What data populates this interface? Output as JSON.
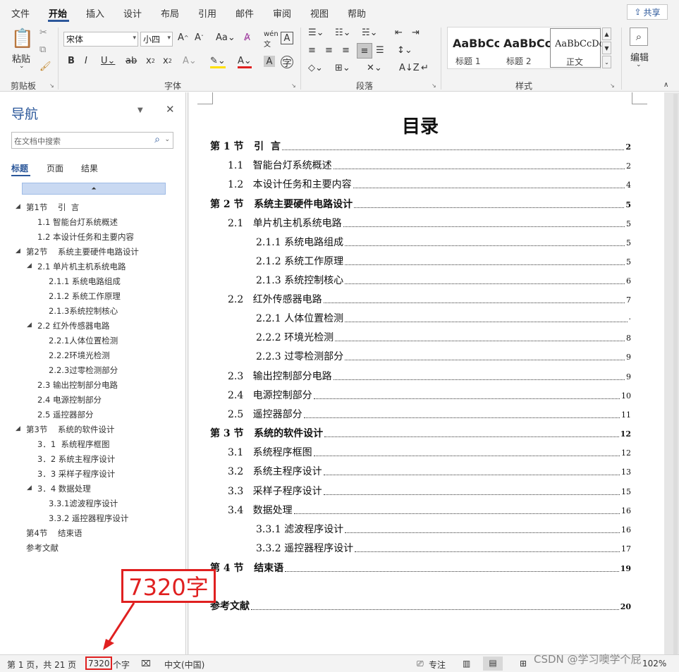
{
  "menu": {
    "items": [
      "文件",
      "开始",
      "插入",
      "设计",
      "布局",
      "引用",
      "邮件",
      "审阅",
      "视图",
      "帮助"
    ],
    "share": "共享"
  },
  "ribbon": {
    "clipboard": {
      "paste": "粘贴",
      "label": "剪贴板"
    },
    "font": {
      "name": "宋体",
      "size": "小四",
      "label": "字体"
    },
    "paragraph": {
      "label": "段落"
    },
    "styles": {
      "label": "样式",
      "items": [
        {
          "sample": "AaBbCc",
          "name": "标题 1"
        },
        {
          "sample": "AaBbCc",
          "name": "标题 2"
        },
        {
          "sample": "AaBbCcDc",
          "name": "正文"
        }
      ]
    },
    "edit": {
      "label": "编辑"
    }
  },
  "nav": {
    "title": "导航",
    "search_placeholder": "在文档中搜索",
    "tabs": [
      "标题",
      "页面",
      "结果"
    ],
    "items": [
      {
        "text": "第1节    引  言",
        "expanded": true
      },
      {
        "text": "1.1 智能台灯系统概述"
      },
      {
        "text": "1.2 本设计任务和主要内容"
      },
      {
        "text": "第2节    系统主要硬件电路设计",
        "expanded": true
      },
      {
        "text": "2.1 单片机主机系统电路",
        "expanded": true
      },
      {
        "text": "2.1.1 系统电路组成"
      },
      {
        "text": "2.1.2 系统工作原理"
      },
      {
        "text": "2.1.3系统控制核心"
      },
      {
        "text": "2.2 红外传感器电路",
        "expanded": true
      },
      {
        "text": "2.2.1人体位置检测"
      },
      {
        "text": "2.2.2环境光检测"
      },
      {
        "text": "2.2.3过零检测部分"
      },
      {
        "text": "2.3 输出控制部分电路"
      },
      {
        "text": "2.4 电源控制部分"
      },
      {
        "text": "2.5 遥控器部分"
      },
      {
        "text": "第3节    系统的软件设计",
        "expanded": true
      },
      {
        "text": "3．1  系统程序框图"
      },
      {
        "text": "3．2 系统主程序设计"
      },
      {
        "text": "3．3 采样子程序设计"
      },
      {
        "text": "3．4 数据处理",
        "expanded": true
      },
      {
        "text": "3.3.1滤波程序设计"
      },
      {
        "text": "3.3.2 遥控器程序设计"
      },
      {
        "text": "第4节    结束语"
      },
      {
        "text": "参考文献"
      }
    ]
  },
  "doc": {
    "title": "目录",
    "toc": [
      {
        "text": "第 1 节   引  言",
        "page": "2"
      },
      {
        "text": "1.1   智能台灯系统概述",
        "page": "2"
      },
      {
        "text": "1.2   本设计任务和主要内容",
        "page": "4"
      },
      {
        "text": "第 2 节   系统主要硬件电路设计",
        "page": "5"
      },
      {
        "text": "2.1   单片机主机系统电路",
        "page": "5"
      },
      {
        "text": "2.1.1 系统电路组成",
        "page": "5"
      },
      {
        "text": "2.1.2 系统工作原理",
        "page": "5"
      },
      {
        "text": "2.1.3 系统控制核心",
        "page": "6"
      },
      {
        "text": "2.2   红外传感器电路",
        "page": "7"
      },
      {
        "text": "2.2.1 人体位置检测",
        "page": "·"
      },
      {
        "text": "2.2.2 环境光检测",
        "page": "8"
      },
      {
        "text": "2.2.3 过零检测部分",
        "page": "9"
      },
      {
        "text": "2.3   输出控制部分电路",
        "page": "9"
      },
      {
        "text": "2.4   电源控制部分",
        "page": "10"
      },
      {
        "text": "2.5   遥控器部分",
        "page": "11"
      },
      {
        "text": "第 3 节   系统的软件设计",
        "page": "12"
      },
      {
        "text": "3.1   系统程序框图",
        "page": "12"
      },
      {
        "text": "3.2   系统主程序设计",
        "page": "13"
      },
      {
        "text": "3.3   采样子程序设计",
        "page": "15"
      },
      {
        "text": "3.4   数据处理",
        "page": "16"
      },
      {
        "text": "3.3.1 滤波程序设计",
        "page": "16"
      },
      {
        "text": "3.3.2 遥控器程序设计",
        "page": "17"
      },
      {
        "text": "第 4 节   结束语",
        "page": "19"
      },
      {
        "text": "参考文献",
        "page": "20"
      }
    ]
  },
  "annotation": {
    "label": "7320字"
  },
  "status": {
    "page": "第 1 页，共 21 页",
    "word_count": "7320",
    "word_unit": "个字",
    "language": "中文(中国)",
    "focus": "专注",
    "zoom": "102%"
  },
  "watermark": "CSDN @学习噢学个屁",
  "colors": {
    "accent": "#2b579a",
    "highlight": "#e02020"
  }
}
